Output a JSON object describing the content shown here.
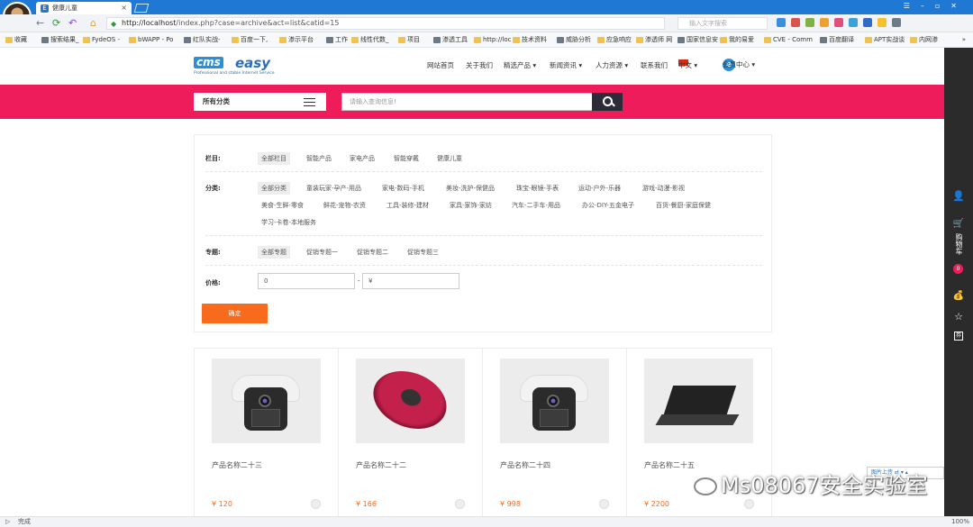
{
  "browser": {
    "tab_title": "健康儿童",
    "tab_favicon": "E",
    "url_host": "http://localhost",
    "url_path": "/index.php?case=archive&act=list&catid=15",
    "search_placeholder": "输入文字搜索",
    "bookmarks": [
      "收藏",
      "搜索结果_",
      "FydeOS - ",
      "bWAPP - Po",
      "红队实战-",
      "百度一下,",
      "渗示平台",
      "工作",
      "线性代数_",
      "项目",
      "渗透工具",
      "http://loc",
      "技术资料",
      "威胁分析",
      "应急响应",
      "渗透师 网",
      "国家信息安",
      "我的易爱",
      "CVE - Comm",
      "百度翻译",
      "APT实战谈",
      "内网渗"
    ],
    "more_bookmarks": "»",
    "status_left": "完成",
    "zoom": "100%"
  },
  "site": {
    "logo_cms": "cms",
    "logo_easy": "easy",
    "logo_tagline": "Professional and stable Internet Service",
    "nav": [
      {
        "label": "网站首页"
      },
      {
        "label": "关于我们"
      },
      {
        "label": "精选产品 ▾"
      },
      {
        "label": "新闻资讯 ▾"
      },
      {
        "label": "人力资源 ▾"
      },
      {
        "label": "联系我们"
      },
      {
        "label": "中文 ▾"
      },
      {
        "label": "会员中心 ▾"
      }
    ],
    "category_button": "所有分类",
    "search_placeholder": "请输入查询信息!"
  },
  "filter": {
    "column_label": "栏目:",
    "columns": [
      "全部栏目",
      "智能产品",
      "家电产品",
      "智能穿戴",
      "健康儿童"
    ],
    "category_label": "分类:",
    "categories_row1": [
      "全部分类",
      "童装玩家-孕产-用品",
      "家电-数码-手机",
      "美妆-洗护-保健品",
      "珠宝-眼镜-手表",
      "运动-户外-乐器",
      "游戏-动漫-影视"
    ],
    "categories_row2": [
      "美食-生鲜-零食",
      "鲜花-宠物-农资",
      "工具-装修-建材",
      "家具-家饰-家纺",
      "汽车-二手车-用品",
      "办公-DIY-五金电子",
      "百货-餐厨-家庭保健"
    ],
    "categories_row3": [
      "学习-卡卷-本地服务"
    ],
    "topic_label": "专题:",
    "topics": [
      "全部专题",
      "促销专题一",
      "促销专题二",
      "促销专题三"
    ],
    "price_label": "价格:",
    "price_min": "0",
    "price_sep": "-",
    "price_max": "¥",
    "confirm": "确定"
  },
  "products": [
    {
      "name": "产品名称二十三",
      "price": "¥ 120",
      "image": "robot"
    },
    {
      "name": "产品名称二十二",
      "price": "¥ 166",
      "image": "pouch"
    },
    {
      "name": "产品名称二十四",
      "price": "¥ 998",
      "image": "robot"
    },
    {
      "name": "产品名称二十五",
      "price": "¥ 2200",
      "image": "laptop"
    }
  ],
  "sidebar": {
    "cart_label": "购物车",
    "cart_count": "0",
    "coupon": "券"
  },
  "overlay": {
    "watermark": "Ms08067安全实验室",
    "float_tag": "图片上传 ⇄ ▾ ▴"
  },
  "colors": {
    "brand_pink": "#ef1c5c",
    "accent_orange": "#f86b1c",
    "browser_blue": "#1e78d4"
  }
}
